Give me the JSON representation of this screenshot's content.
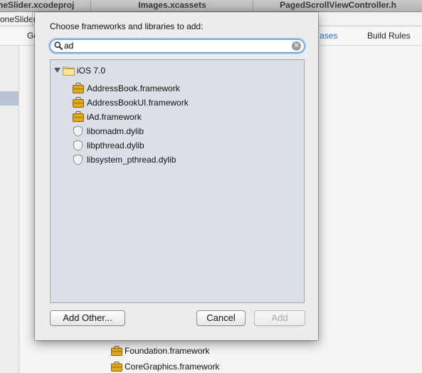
{
  "tabs": [
    {
      "label": "neSlider.xcodeproj"
    },
    {
      "label": "Images.xcassets"
    },
    {
      "label": "PagedScrollViewController.h"
    }
  ],
  "breadcrumb": {
    "label": "oneSlider"
  },
  "editor_tabs": {
    "general_fragment": "Ge",
    "build_phases_fragment": "ases",
    "build_rules": "Build Rules"
  },
  "background_list": [
    {
      "label": "Foundation.framework",
      "faded": false
    },
    {
      "label": "CoreGraphics.framework",
      "faded": false
    }
  ],
  "dialog": {
    "prompt": "Choose frameworks and libraries to add:",
    "search": {
      "value": "ad",
      "placeholder": ""
    },
    "group": {
      "label": "iOS 7.0",
      "expanded": true
    },
    "items": [
      {
        "label": "AddressBook.framework",
        "kind": "framework"
      },
      {
        "label": "AddressBookUI.framework",
        "kind": "framework"
      },
      {
        "label": "iAd.framework",
        "kind": "framework"
      },
      {
        "label": "libomadm.dylib",
        "kind": "dylib"
      },
      {
        "label": "libpthread.dylib",
        "kind": "dylib"
      },
      {
        "label": "libsystem_pthread.dylib",
        "kind": "dylib"
      }
    ],
    "buttons": {
      "add_other": "Add Other...",
      "cancel": "Cancel",
      "add": "Add"
    }
  },
  "colors": {
    "accent": "#2a6fc0",
    "list_background": "#dbe0e8",
    "framework_icon": "#e2a91c"
  },
  "icons": {
    "search": "magnifier-icon",
    "clear": "clear-search-icon",
    "folder": "folder-icon",
    "framework": "toolbox-icon",
    "dylib": "shield-icon"
  }
}
